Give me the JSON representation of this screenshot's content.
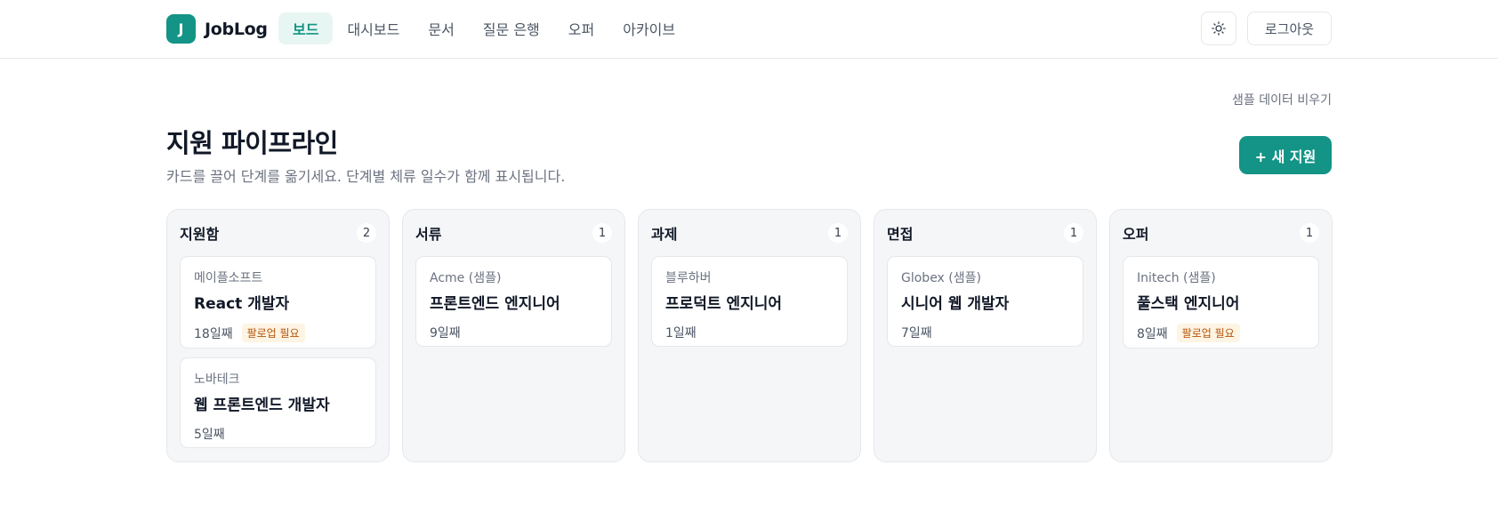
{
  "header": {
    "logo_letter": "J",
    "brand": "JobLog",
    "nav": [
      {
        "label": "보드",
        "active": true
      },
      {
        "label": "대시보드",
        "active": false
      },
      {
        "label": "문서",
        "active": false
      },
      {
        "label": "질문 은행",
        "active": false
      },
      {
        "label": "오퍼",
        "active": false
      },
      {
        "label": "아카이브",
        "active": false
      }
    ],
    "theme_icon": "sun-icon",
    "logout_label": "로그아웃"
  },
  "main": {
    "clear_sample_label": "샘플 데이터 비우기",
    "title": "지원 파이프라인",
    "subtitle": "카드를 끌어 단계를 옮기세요. 단계별 체류 일수가 함께 표시됩니다.",
    "new_button_label": "+ 새 지원"
  },
  "columns": [
    {
      "title": "지원함",
      "count": "2",
      "cards": [
        {
          "company": "메이플소프트",
          "role": "React 개발자",
          "days": "18일째",
          "badge": "팔로업 필요"
        },
        {
          "company": "노바테크",
          "role": "웹 프론트엔드 개발자",
          "days": "5일째",
          "badge": ""
        }
      ]
    },
    {
      "title": "서류",
      "count": "1",
      "cards": [
        {
          "company": "Acme (샘플)",
          "role": "프론트엔드 엔지니어",
          "days": "9일째",
          "badge": ""
        }
      ]
    },
    {
      "title": "과제",
      "count": "1",
      "cards": [
        {
          "company": "블루하버",
          "role": "프로덕트 엔지니어",
          "days": "1일째",
          "badge": ""
        }
      ]
    },
    {
      "title": "면접",
      "count": "1",
      "cards": [
        {
          "company": "Globex (샘플)",
          "role": "시니어 웹 개발자",
          "days": "7일째",
          "badge": ""
        }
      ]
    },
    {
      "title": "오퍼",
      "count": "1",
      "cards": [
        {
          "company": "Initech (샘플)",
          "role": "풀스택 엔지니어",
          "days": "8일째",
          "badge": "팔로업 필요"
        }
      ]
    }
  ],
  "colors": {
    "accent": "#139486",
    "accent_soft": "#e8f6f3",
    "badge_text": "#b45309",
    "badge_bg": "#fdf4e3"
  }
}
